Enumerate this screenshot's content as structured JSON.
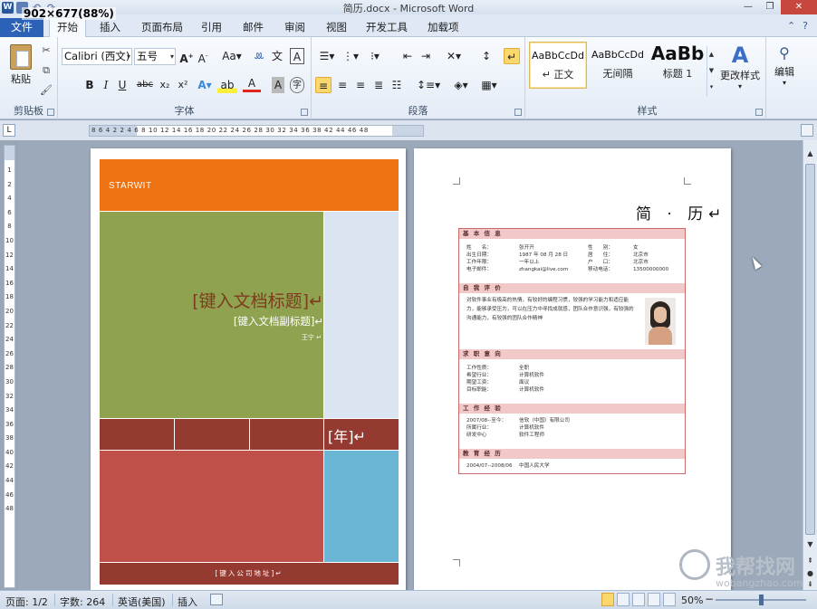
{
  "window": {
    "title": "简历.docx - Microsoft Word",
    "dimension_overlay": "902×677(88%)"
  },
  "tabs": [
    {
      "label": "文件"
    },
    {
      "label": "开始"
    },
    {
      "label": "插入"
    },
    {
      "label": "页面布局"
    },
    {
      "label": "引用"
    },
    {
      "label": "邮件"
    },
    {
      "label": "审阅"
    },
    {
      "label": "视图"
    },
    {
      "label": "开发工具"
    },
    {
      "label": "加载项"
    }
  ],
  "ribbon": {
    "clipboard": {
      "paste_label": "粘贴",
      "group_label": "剪贴板"
    },
    "font": {
      "font_name": "Calibri (西文)",
      "font_size": "五号",
      "group_label": "字体",
      "bold": "B",
      "italic": "I",
      "underline": "U",
      "strike": "abc",
      "subscript": "x₂",
      "superscript": "x²"
    },
    "paragraph": {
      "group_label": "段落"
    },
    "styles": {
      "group_label": "样式",
      "items": [
        {
          "sample": "AaBbCcDd",
          "name": "↵ 正文"
        },
        {
          "sample": "AaBbCcDd",
          "name": "无间隔"
        },
        {
          "sample": "AaBb",
          "name": "标题 1"
        }
      ],
      "change_styles": "更改样式"
    },
    "editing": {
      "label": "编辑"
    }
  },
  "ruler": {
    "ticks": "8  6  4  2     2  4  6  8  10 12 14 16 18 20 22 24 26 28 30 32 34 36 38    42 44 46 48",
    "vertical": [
      "1",
      "2",
      "4",
      "6",
      "8",
      "10",
      "12",
      "14",
      "16",
      "18",
      "20",
      "22",
      "24",
      "26",
      "28",
      "30",
      "32",
      "34",
      "36",
      "38",
      "40",
      "42",
      "44",
      "46",
      "48"
    ]
  },
  "cover": {
    "brand": "STARWIT",
    "title": "[键入文档标题]↵",
    "subtitle": "[键入文档副标题]↵",
    "author": "王宁 ↵",
    "year": "[年]↵",
    "address": "[键入公司地址]↵",
    "colors": {
      "orange": "#ee7212",
      "green": "#8ea24f",
      "lightblue": "#dbe5f1",
      "darkred": "#953a31",
      "red": "#c0514a",
      "blue": "#6bb6d5"
    }
  },
  "resume": {
    "heading": "简 · 历↵",
    "sections": {
      "basic": "基 本 信 息",
      "evaluation": "自 我 评 价",
      "skills": "求 职 意 向",
      "work": "工 作 经 验",
      "education": "教 育 经 历"
    },
    "basic_rows": [
      [
        "姓　　名：",
        "张开开",
        "性　　别：",
        "女"
      ],
      [
        "出生日期：",
        "1987 年 08 月 28 日",
        "居　　住：",
        "北京市"
      ],
      [
        "工作年限：",
        "一年以上",
        "户　　口：",
        "北京市"
      ],
      [
        "电子邮件：",
        "zhangkai@live.com",
        "移动电话：",
        "13500000000"
      ]
    ],
    "evaluation_text": "对软件事业有极高的热情，有较好的编程习惯，较强的学习能力和适应能力，能够承受压力，可以在压力中寻找成就感，团队合作意识强，有较强的沟通能力，有较强的团队合作精神",
    "skills_rows": [
      [
        "工作性质：",
        "全职"
      ],
      [
        "希望行业：",
        "计算机软件"
      ],
      [
        "期望工资：",
        "面议"
      ],
      [
        "目标职能：",
        "计算机软件"
      ]
    ],
    "work_rows": [
      [
        "2007/08--至今：",
        "信软（中国）有限公司"
      ],
      [
        "所属行业：",
        "计算机软件"
      ],
      [
        "研发中心",
        "软件工程师"
      ]
    ],
    "education_rows": [
      [
        "2004/07--2008/06",
        "中国人民大学"
      ]
    ]
  },
  "watermark": {
    "text": "我帮找网",
    "url": "wobangzhao.com"
  },
  "statusbar": {
    "page": "页面: 1/2",
    "words": "字数: 264",
    "language": "英语(美国)",
    "mode": "插入",
    "zoom": "50%"
  }
}
